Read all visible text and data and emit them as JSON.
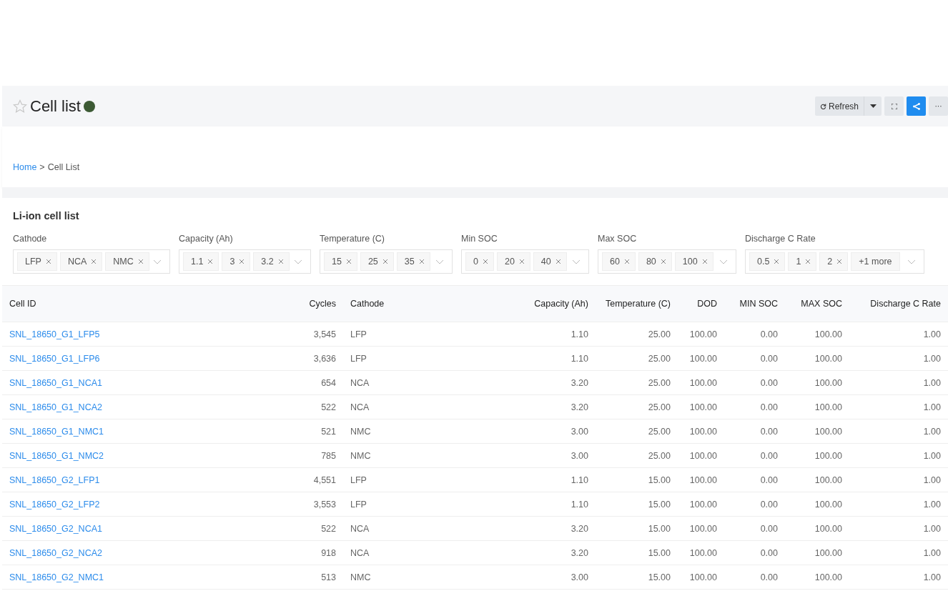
{
  "header": {
    "title": "Cell list",
    "starred": false,
    "buttons": [
      {
        "kind": "refresh",
        "label": "Refresh"
      },
      {
        "kind": "caret"
      },
      {
        "kind": "fullscreen"
      },
      {
        "kind": "share",
        "selected": true
      },
      {
        "kind": "more",
        "label": "···"
      }
    ]
  },
  "breadcrumb": [
    {
      "label": "Home",
      "kind": "link"
    },
    {
      "label": ">",
      "kind": "separator"
    },
    {
      "label": "Cell List",
      "kind": "current"
    }
  ],
  "card_title": "Li-ion cell list",
  "filters": [
    {
      "label": "Cathode",
      "tags": [
        "LFP",
        "NCA",
        "NMC"
      ]
    },
    {
      "label": "Capacity (Ah)",
      "tags": [
        "1.1",
        "3",
        "3.2"
      ]
    },
    {
      "label": "Temperature (C)",
      "tags": [
        "15",
        "25",
        "35"
      ]
    },
    {
      "label": "Min SOC",
      "tags": [
        "0",
        "20",
        "40"
      ]
    },
    {
      "label": "Max SOC",
      "tags": [
        "60",
        "80",
        "100"
      ]
    },
    {
      "label": "Discharge C Rate",
      "tags": [
        "0.5",
        "1",
        "2"
      ],
      "more": "+1 more"
    }
  ],
  "table": {
    "columns": [
      {
        "label": "Cell ID",
        "kind": "link"
      },
      {
        "label": "Cycles",
        "kind": "number"
      },
      {
        "label": "Cathode",
        "kind": "text"
      },
      {
        "label": "Capacity (Ah)",
        "kind": "number"
      },
      {
        "label": "Temperature (C)",
        "kind": "number"
      },
      {
        "label": "DOD",
        "kind": "number"
      },
      {
        "label": "MIN SOC",
        "kind": "number"
      },
      {
        "label": "MAX SOC",
        "kind": "number"
      },
      {
        "label": "Discharge C Rate",
        "kind": "number"
      }
    ],
    "rows": [
      [
        "SNL_18650_G1_LFP5",
        "3,545",
        "LFP",
        "1.10",
        "25.00",
        "100.00",
        "0.00",
        "100.00",
        "1.00"
      ],
      [
        "SNL_18650_G1_LFP6",
        "3,636",
        "LFP",
        "1.10",
        "25.00",
        "100.00",
        "0.00",
        "100.00",
        "1.00"
      ],
      [
        "SNL_18650_G1_NCA1",
        "654",
        "NCA",
        "3.20",
        "25.00",
        "100.00",
        "0.00",
        "100.00",
        "1.00"
      ],
      [
        "SNL_18650_G1_NCA2",
        "522",
        "NCA",
        "3.20",
        "25.00",
        "100.00",
        "0.00",
        "100.00",
        "1.00"
      ],
      [
        "SNL_18650_G1_NMC1",
        "521",
        "NMC",
        "3.00",
        "25.00",
        "100.00",
        "0.00",
        "100.00",
        "1.00"
      ],
      [
        "SNL_18650_G1_NMC2",
        "785",
        "NMC",
        "3.00",
        "25.00",
        "100.00",
        "0.00",
        "100.00",
        "1.00"
      ],
      [
        "SNL_18650_G2_LFP1",
        "4,551",
        "LFP",
        "1.10",
        "15.00",
        "100.00",
        "0.00",
        "100.00",
        "1.00"
      ],
      [
        "SNL_18650_G2_LFP2",
        "3,553",
        "LFP",
        "1.10",
        "15.00",
        "100.00",
        "0.00",
        "100.00",
        "1.00"
      ],
      [
        "SNL_18650_G2_NCA1",
        "522",
        "NCA",
        "3.20",
        "15.00",
        "100.00",
        "0.00",
        "100.00",
        "1.00"
      ],
      [
        "SNL_18650_G2_NCA2",
        "918",
        "NCA",
        "3.20",
        "15.00",
        "100.00",
        "0.00",
        "100.00",
        "1.00"
      ],
      [
        "SNL_18650_G2_NMC1",
        "513",
        "NMC",
        "3.00",
        "15.00",
        "100.00",
        "0.00",
        "100.00",
        "1.00"
      ]
    ]
  }
}
